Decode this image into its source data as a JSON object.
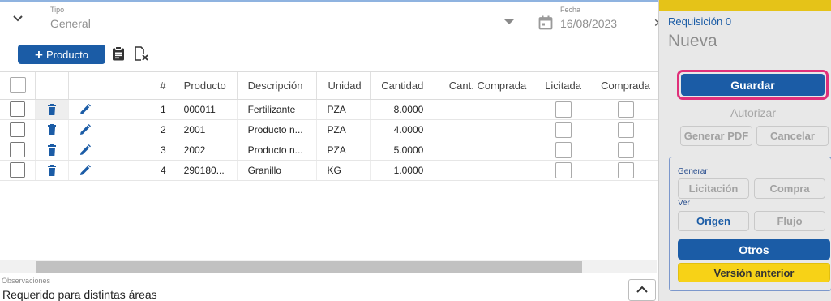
{
  "form": {
    "tipo_label": "Tipo",
    "tipo_value": "General",
    "fecha_label": "Fecha",
    "fecha_value": "16/08/2023",
    "collapse_icon": "chevron-down-icon",
    "calendar_icon": "calendar-icon"
  },
  "toolbar": {
    "add_product_label": "Producto",
    "add_product_icon": "plus-icon",
    "clipboard_icon": "clipboard-list-icon",
    "clear_icon": "document-remove-icon"
  },
  "table": {
    "columns": [
      "#",
      "Producto",
      "Descripción",
      "Unidad",
      "Cantidad",
      "Cant. Comprada",
      "Licitada",
      "Comprada"
    ],
    "rows": [
      {
        "num": "1",
        "producto": "000011",
        "descripcion": "Fertilizante",
        "unidad": "PZA",
        "cantidad": "8.0000",
        "cant_comprada": "",
        "licitada": false,
        "comprada": false
      },
      {
        "num": "2",
        "producto": "2001",
        "descripcion": "Producto n...",
        "unidad": "PZA",
        "cantidad": "4.0000",
        "cant_comprada": "",
        "licitada": false,
        "comprada": false
      },
      {
        "num": "3",
        "producto": "2002",
        "descripcion": "Producto n...",
        "unidad": "PZA",
        "cantidad": "5.0000",
        "cant_comprada": "",
        "licitada": false,
        "comprada": false
      },
      {
        "num": "4",
        "producto": "290180...",
        "descripcion": "Granillo",
        "unidad": "KG",
        "cantidad": "1.0000",
        "cant_comprada": "",
        "licitada": false,
        "comprada": false
      }
    ],
    "row_icons": {
      "delete": "trash-icon",
      "edit": "pencil-icon"
    }
  },
  "observaciones": {
    "label": "Observaciones",
    "value": "Requerido para distintas áreas",
    "toggle_icon": "chevron-up-icon"
  },
  "panel": {
    "title": "Requisición 0",
    "status": "Nueva",
    "save_label": "Guardar",
    "authorize_label": "Autorizar",
    "pdf_label": "Generar PDF",
    "cancel_label": "Cancelar",
    "generar_label": "Generar",
    "licitacion_label": "Licitación",
    "compra_label": "Compra",
    "ver_label": "Ver",
    "origen_label": "Origen",
    "flujo_label": "Flujo",
    "otros_label": "Otros",
    "version_label": "Versión anterior"
  },
  "colors": {
    "primary": "#1b5ca6",
    "accent_yellow": "#f7d217",
    "focus_ring": "#e0307a",
    "panel_bg": "#e8e8e8"
  }
}
